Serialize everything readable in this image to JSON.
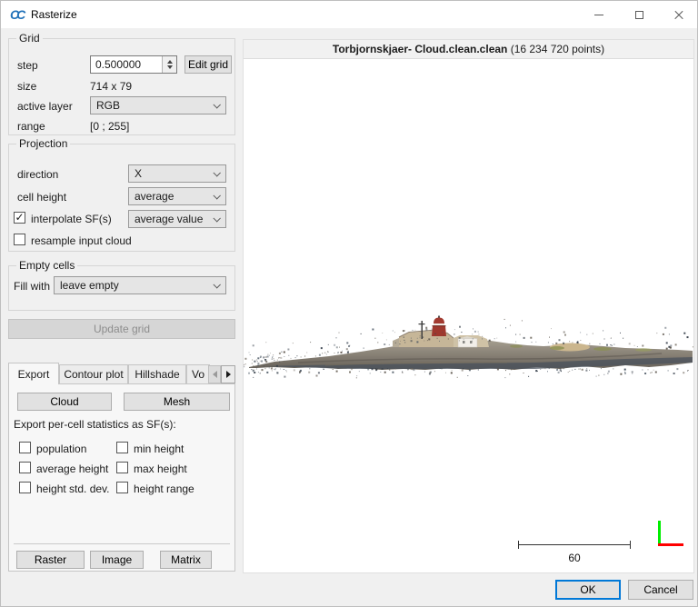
{
  "window": {
    "title": "Rasterize"
  },
  "grid": {
    "label": "Grid",
    "step_label": "step",
    "step_value": "0.500000",
    "edit_grid_label": "Edit grid",
    "size_label": "size",
    "size_value": "714 x 79",
    "active_layer_label": "active layer",
    "active_layer_value": "RGB",
    "range_label": "range",
    "range_value": "[0 ; 255]"
  },
  "projection": {
    "label": "Projection",
    "direction_label": "direction",
    "direction_value": "X",
    "cell_height_label": "cell height",
    "cell_height_value": "average",
    "interpolate_label": "interpolate SF(s)",
    "interpolate_checked": true,
    "interpolate_check_glyph": "✓",
    "interpolate_value": "average value",
    "resample_label": "resample input cloud",
    "resample_checked": false
  },
  "empty_cells": {
    "label": "Empty cells",
    "fill_with_label": "Fill with",
    "fill_with_value": "leave empty"
  },
  "update_grid_label": "Update grid",
  "tabs": [
    {
      "label": "Export",
      "active": true
    },
    {
      "label": "Contour plot",
      "active": false
    },
    {
      "label": "Hillshade",
      "active": false
    },
    {
      "label": "Vo",
      "active": false
    }
  ],
  "export_tab": {
    "cloud_label": "Cloud",
    "mesh_label": "Mesh",
    "stats_label": "Export per-cell statistics as SF(s):",
    "checkboxes": [
      "population",
      "min height",
      "average height",
      "max height",
      "height std. dev.",
      "height range"
    ],
    "raster_label": "Raster",
    "image_label": "Image",
    "matrix_label": "Matrix"
  },
  "viewport": {
    "title_bold": "Torbjornskjaer- Cloud.clean.clean",
    "title_rest": " (16 234 720 points)",
    "scale_value": "60"
  },
  "footer": {
    "ok_label": "OK",
    "cancel_label": "Cancel"
  },
  "colors": {
    "accent": "#0078d7",
    "axis_x": "#ff0000",
    "axis_y": "#00ee00",
    "dialog_bg": "#f0f0f0"
  }
}
